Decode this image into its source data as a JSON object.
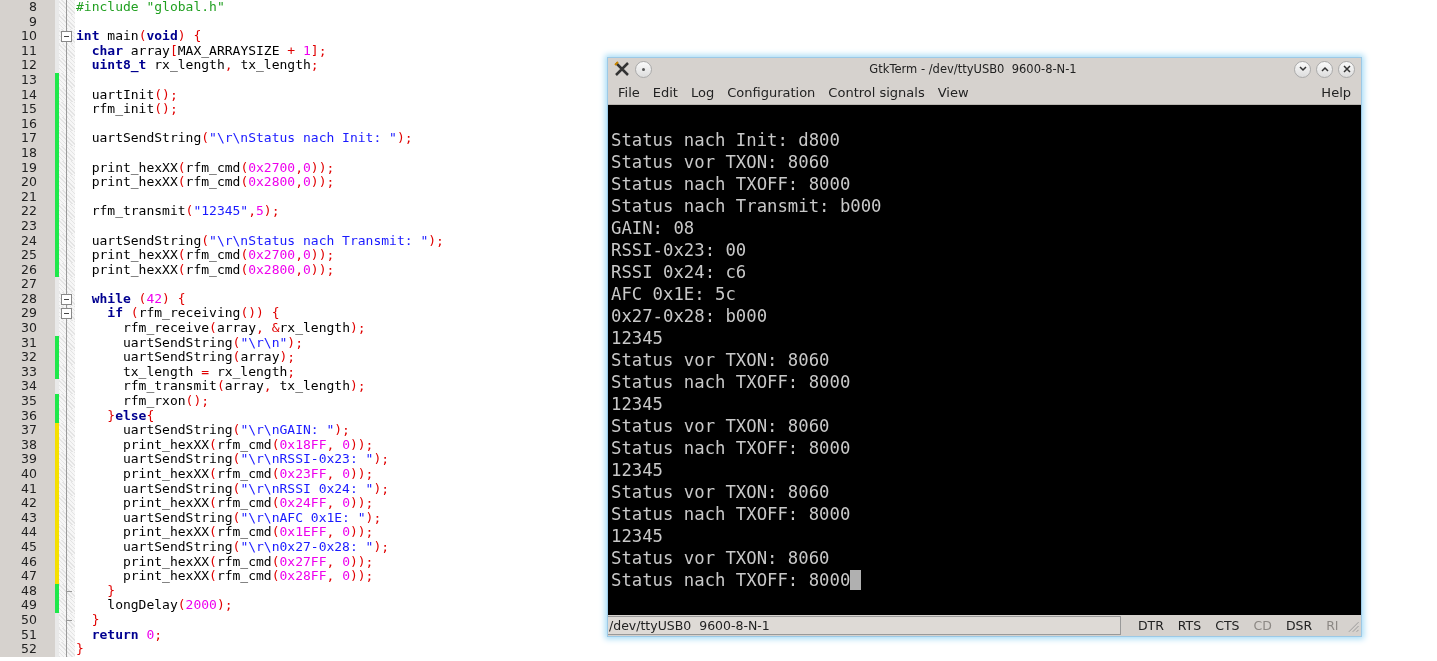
{
  "editor": {
    "lines": [
      {
        "number": "8",
        "tokens": [
          {
            "kind": "pre",
            "t": "#include \"global.h\""
          }
        ]
      },
      {
        "number": "9"
      },
      {
        "number": "10",
        "expanded": true,
        "tokens": [
          {
            "kind": "kw",
            "t": "int"
          },
          {
            "kind": "plain",
            "t": " main"
          },
          {
            "kind": "op",
            "t": "("
          },
          {
            "kind": "kw",
            "t": "void"
          },
          {
            "kind": "op",
            "t": ") {"
          }
        ]
      },
      {
        "number": "11",
        "tokens": [
          {
            "kind": "kw",
            "t": "  char"
          },
          {
            "kind": "plain",
            "t": " array"
          },
          {
            "kind": "op",
            "t": "["
          },
          {
            "kind": "plain",
            "t": "MAX_ARRAYSIZE "
          },
          {
            "kind": "op",
            "t": "+ "
          },
          {
            "kind": "num",
            "t": "1"
          },
          {
            "kind": "op",
            "t": "];"
          }
        ]
      },
      {
        "number": "12",
        "tokens": [
          {
            "kind": "kw",
            "t": "  uint8_t"
          },
          {
            "kind": "plain",
            "t": " rx_length"
          },
          {
            "kind": "op",
            "t": ","
          },
          {
            "kind": "plain",
            "t": " tx_length"
          },
          {
            "kind": "op",
            "t": ";"
          }
        ]
      },
      {
        "number": "13",
        "color": "#1ee84a"
      },
      {
        "number": "14",
        "color": "#1ee84a",
        "tokens": [
          {
            "kind": "plain",
            "t": "  uartInit"
          },
          {
            "kind": "op",
            "t": "();"
          }
        ]
      },
      {
        "number": "15",
        "color": "#1ee84a",
        "tokens": [
          {
            "kind": "plain",
            "t": "  rfm_init"
          },
          {
            "kind": "op",
            "t": "();"
          }
        ]
      },
      {
        "number": "16",
        "color": "#1ee84a"
      },
      {
        "number": "17",
        "color": "#1ee84a",
        "tokens": [
          {
            "kind": "plain",
            "t": "  uartSendString"
          },
          {
            "kind": "op",
            "t": "("
          },
          {
            "kind": "str",
            "t": "\"\\r\\nStatus nach Init: \""
          },
          {
            "kind": "op",
            "t": ");"
          }
        ]
      },
      {
        "number": "18",
        "color": "#1ee84a"
      },
      {
        "number": "19",
        "color": "#1ee84a",
        "tokens": [
          {
            "kind": "plain",
            "t": "  print_hexXX"
          },
          {
            "kind": "op",
            "t": "("
          },
          {
            "kind": "plain",
            "t": "rfm_cmd"
          },
          {
            "kind": "op",
            "t": "("
          },
          {
            "kind": "num",
            "t": "0x2700"
          },
          {
            "kind": "op",
            "t": ","
          },
          {
            "kind": "num",
            "t": "0"
          },
          {
            "kind": "op",
            "t": "));"
          }
        ]
      },
      {
        "number": "20",
        "color": "#1ee84a",
        "tokens": [
          {
            "kind": "plain",
            "t": "  print_hexXX"
          },
          {
            "kind": "op",
            "t": "("
          },
          {
            "kind": "plain",
            "t": "rfm_cmd"
          },
          {
            "kind": "op",
            "t": "("
          },
          {
            "kind": "num",
            "t": "0x2800"
          },
          {
            "kind": "op",
            "t": ","
          },
          {
            "kind": "num",
            "t": "0"
          },
          {
            "kind": "op",
            "t": "));"
          }
        ]
      },
      {
        "number": "21",
        "color": "#1ee84a"
      },
      {
        "number": "22",
        "color": "#1ee84a",
        "tokens": [
          {
            "kind": "plain",
            "t": "  rfm_transmit"
          },
          {
            "kind": "op",
            "t": "("
          },
          {
            "kind": "str",
            "t": "\"12345\""
          },
          {
            "kind": "op",
            "t": ","
          },
          {
            "kind": "num",
            "t": "5"
          },
          {
            "kind": "op",
            "t": ");"
          }
        ]
      },
      {
        "number": "23",
        "color": "#1ee84a"
      },
      {
        "number": "24",
        "color": "#1ee84a",
        "tokens": [
          {
            "kind": "plain",
            "t": "  uartSendString"
          },
          {
            "kind": "op",
            "t": "("
          },
          {
            "kind": "str",
            "t": "\"\\r\\nStatus nach Transmit: \""
          },
          {
            "kind": "op",
            "t": ");"
          }
        ]
      },
      {
        "number": "25",
        "color": "#1ee84a",
        "tokens": [
          {
            "kind": "plain",
            "t": "  print_hexXX"
          },
          {
            "kind": "op",
            "t": "("
          },
          {
            "kind": "plain",
            "t": "rfm_cmd"
          },
          {
            "kind": "op",
            "t": "("
          },
          {
            "kind": "num",
            "t": "0x2700"
          },
          {
            "kind": "op",
            "t": ","
          },
          {
            "kind": "num",
            "t": "0"
          },
          {
            "kind": "op",
            "t": "));"
          }
        ]
      },
      {
        "number": "26",
        "color": "#1ee84a",
        "tokens": [
          {
            "kind": "plain",
            "t": "  print_hexXX"
          },
          {
            "kind": "op",
            "t": "("
          },
          {
            "kind": "plain",
            "t": "rfm_cmd"
          },
          {
            "kind": "op",
            "t": "("
          },
          {
            "kind": "num",
            "t": "0x2800"
          },
          {
            "kind": "op",
            "t": ","
          },
          {
            "kind": "num",
            "t": "0"
          },
          {
            "kind": "op",
            "t": "));"
          }
        ]
      },
      {
        "number": "27"
      },
      {
        "number": "28",
        "expanded": true,
        "tokens": [
          {
            "kind": "kw",
            "t": "  while"
          },
          {
            "kind": "op",
            "t": " ("
          },
          {
            "kind": "num",
            "t": "42"
          },
          {
            "kind": "op",
            "t": ") {"
          }
        ]
      },
      {
        "number": "29",
        "expanded": true,
        "tokens": [
          {
            "kind": "kw",
            "t": "    if"
          },
          {
            "kind": "op",
            "t": " ("
          },
          {
            "kind": "plain",
            "t": "rfm_receiving"
          },
          {
            "kind": "op",
            "t": "()) {"
          }
        ]
      },
      {
        "number": "30",
        "tokens": [
          {
            "kind": "plain",
            "t": "      rfm_receive"
          },
          {
            "kind": "op",
            "t": "("
          },
          {
            "kind": "plain",
            "t": "array"
          },
          {
            "kind": "op",
            "t": ", &"
          },
          {
            "kind": "plain",
            "t": "rx_length"
          },
          {
            "kind": "op",
            "t": ");"
          }
        ]
      },
      {
        "number": "31",
        "color": "#1ee84a",
        "tokens": [
          {
            "kind": "plain",
            "t": "      uartSendString"
          },
          {
            "kind": "op",
            "t": "("
          },
          {
            "kind": "str",
            "t": "\"\\r\\n\""
          },
          {
            "kind": "op",
            "t": ");"
          }
        ]
      },
      {
        "number": "32",
        "color": "#1ee84a",
        "tokens": [
          {
            "kind": "plain",
            "t": "      uartSendString"
          },
          {
            "kind": "op",
            "t": "("
          },
          {
            "kind": "plain",
            "t": "array"
          },
          {
            "kind": "op",
            "t": ");"
          }
        ]
      },
      {
        "number": "33",
        "color": "#1ee84a",
        "tokens": [
          {
            "kind": "plain",
            "t": "      tx_length "
          },
          {
            "kind": "op",
            "t": "="
          },
          {
            "kind": "plain",
            "t": " rx_length"
          },
          {
            "kind": "op",
            "t": ";"
          }
        ]
      },
      {
        "number": "34",
        "tokens": [
          {
            "kind": "plain",
            "t": "      rfm_transmit"
          },
          {
            "kind": "op",
            "t": "("
          },
          {
            "kind": "plain",
            "t": "array"
          },
          {
            "kind": "op",
            "t": ","
          },
          {
            "kind": "plain",
            "t": " tx_length"
          },
          {
            "kind": "op",
            "t": ");"
          }
        ]
      },
      {
        "number": "35",
        "color": "#1ee84a",
        "tokens": [
          {
            "kind": "plain",
            "t": "      rfm_rxon"
          },
          {
            "kind": "op",
            "t": "();"
          }
        ]
      },
      {
        "number": "36",
        "color": "#1ee84a",
        "tokens": [
          {
            "kind": "op",
            "t": "    }"
          },
          {
            "kind": "kw",
            "t": "else"
          },
          {
            "kind": "op",
            "t": "{"
          }
        ]
      },
      {
        "number": "37",
        "color": "#f5e000",
        "tokens": [
          {
            "kind": "plain",
            "t": "      uartSendString"
          },
          {
            "kind": "op",
            "t": "("
          },
          {
            "kind": "str",
            "t": "\"\\r\\nGAIN: \""
          },
          {
            "kind": "op",
            "t": ");"
          }
        ]
      },
      {
        "number": "38",
        "color": "#f5e000",
        "tokens": [
          {
            "kind": "plain",
            "t": "      print_hexXX"
          },
          {
            "kind": "op",
            "t": "("
          },
          {
            "kind": "plain",
            "t": "rfm_cmd"
          },
          {
            "kind": "op",
            "t": "("
          },
          {
            "kind": "num",
            "t": "0x18FF"
          },
          {
            "kind": "op",
            "t": ", "
          },
          {
            "kind": "num",
            "t": "0"
          },
          {
            "kind": "op",
            "t": "));"
          }
        ]
      },
      {
        "number": "39",
        "color": "#f5e000",
        "tokens": [
          {
            "kind": "plain",
            "t": "      uartSendString"
          },
          {
            "kind": "op",
            "t": "("
          },
          {
            "kind": "str",
            "t": "\"\\r\\nRSSI-0x23: \""
          },
          {
            "kind": "op",
            "t": ");"
          }
        ]
      },
      {
        "number": "40",
        "color": "#f5e000",
        "tokens": [
          {
            "kind": "plain",
            "t": "      print_hexXX"
          },
          {
            "kind": "op",
            "t": "("
          },
          {
            "kind": "plain",
            "t": "rfm_cmd"
          },
          {
            "kind": "op",
            "t": "("
          },
          {
            "kind": "num",
            "t": "0x23FF"
          },
          {
            "kind": "op",
            "t": ", "
          },
          {
            "kind": "num",
            "t": "0"
          },
          {
            "kind": "op",
            "t": "));"
          }
        ]
      },
      {
        "number": "41",
        "color": "#f5e000",
        "tokens": [
          {
            "kind": "plain",
            "t": "      uartSendString"
          },
          {
            "kind": "op",
            "t": "("
          },
          {
            "kind": "str",
            "t": "\"\\r\\nRSSI 0x24: \""
          },
          {
            "kind": "op",
            "t": ");"
          }
        ]
      },
      {
        "number": "42",
        "color": "#f5e000",
        "tokens": [
          {
            "kind": "plain",
            "t": "      print_hexXX"
          },
          {
            "kind": "op",
            "t": "("
          },
          {
            "kind": "plain",
            "t": "rfm_cmd"
          },
          {
            "kind": "op",
            "t": "("
          },
          {
            "kind": "num",
            "t": "0x24FF"
          },
          {
            "kind": "op",
            "t": ", "
          },
          {
            "kind": "num",
            "t": "0"
          },
          {
            "kind": "op",
            "t": "));"
          }
        ]
      },
      {
        "number": "43",
        "color": "#f5e000",
        "tokens": [
          {
            "kind": "plain",
            "t": "      uartSendString"
          },
          {
            "kind": "op",
            "t": "("
          },
          {
            "kind": "str",
            "t": "\"\\r\\nAFC 0x1E: \""
          },
          {
            "kind": "op",
            "t": ");"
          }
        ]
      },
      {
        "number": "44",
        "color": "#f5e000",
        "tokens": [
          {
            "kind": "plain",
            "t": "      print_hexXX"
          },
          {
            "kind": "op",
            "t": "("
          },
          {
            "kind": "plain",
            "t": "rfm_cmd"
          },
          {
            "kind": "op",
            "t": "("
          },
          {
            "kind": "num",
            "t": "0x1EFF"
          },
          {
            "kind": "op",
            "t": ", "
          },
          {
            "kind": "num",
            "t": "0"
          },
          {
            "kind": "op",
            "t": "));"
          }
        ]
      },
      {
        "number": "45",
        "color": "#f5e000",
        "tokens": [
          {
            "kind": "plain",
            "t": "      uartSendString"
          },
          {
            "kind": "op",
            "t": "("
          },
          {
            "kind": "str",
            "t": "\"\\r\\n0x27-0x28: \""
          },
          {
            "kind": "op",
            "t": ");"
          }
        ]
      },
      {
        "number": "46",
        "color": "#f5e000",
        "tokens": [
          {
            "kind": "plain",
            "t": "      print_hexXX"
          },
          {
            "kind": "op",
            "t": "("
          },
          {
            "kind": "plain",
            "t": "rfm_cmd"
          },
          {
            "kind": "op",
            "t": "("
          },
          {
            "kind": "num",
            "t": "0x27FF"
          },
          {
            "kind": "op",
            "t": ", "
          },
          {
            "kind": "num",
            "t": "0"
          },
          {
            "kind": "op",
            "t": "));"
          }
        ]
      },
      {
        "number": "47",
        "color": "#f5e000",
        "tokens": [
          {
            "kind": "plain",
            "t": "      print_hexXX"
          },
          {
            "kind": "op",
            "t": "("
          },
          {
            "kind": "plain",
            "t": "rfm_cmd"
          },
          {
            "kind": "op",
            "t": "("
          },
          {
            "kind": "num",
            "t": "0x28FF"
          },
          {
            "kind": "op",
            "t": ", "
          },
          {
            "kind": "num",
            "t": "0"
          },
          {
            "kind": "op",
            "t": "));"
          }
        ]
      },
      {
        "number": "48",
        "color": "#1ee84a",
        "block_end": true,
        "tokens": [
          {
            "kind": "op",
            "t": "    }"
          }
        ]
      },
      {
        "number": "49",
        "color": "#1ee84a",
        "tokens": [
          {
            "kind": "plain",
            "t": "    longDelay"
          },
          {
            "kind": "op",
            "t": "("
          },
          {
            "kind": "num",
            "t": "2000"
          },
          {
            "kind": "op",
            "t": ");"
          }
        ]
      },
      {
        "number": "50",
        "block_end": true,
        "tokens": [
          {
            "kind": "op",
            "t": "  }"
          }
        ]
      },
      {
        "number": "51",
        "tokens": [
          {
            "kind": "kw",
            "t": "  return"
          },
          {
            "kind": "num",
            "t": " 0"
          },
          {
            "kind": "op",
            "t": ";"
          }
        ]
      },
      {
        "number": "52",
        "tokens": [
          {
            "kind": "op",
            "t": "}"
          }
        ]
      }
    ]
  },
  "terminal": {
    "title": "GtkTerm - /dev/ttyUSB0  9600-8-N-1",
    "menu": [
      "File",
      "Edit",
      "Log",
      "Configuration",
      "Control signals",
      "View"
    ],
    "help": "Help",
    "output": [
      "Status nach Init: d800",
      "Status vor TXON: 8060",
      "Status nach TXOFF: 8000",
      "Status nach Transmit: b000",
      "GAIN: 08",
      "RSSI-0x23: 00",
      "RSSI 0x24: c6",
      "AFC 0x1E: 5c",
      "0x27-0x28: b000",
      "12345",
      "Status vor TXON: 8060",
      "Status nach TXOFF: 8000",
      "12345",
      "Status vor TXON: 8060",
      "Status nach TXOFF: 8000",
      "12345",
      "Status vor TXON: 8060",
      "Status nach TXOFF: 8000",
      "12345",
      "Status vor TXON: 8060",
      "Status nach TXOFF: 8000"
    ],
    "status": {
      "port": "/dev/ttyUSB0  9600-8-N-1",
      "signals": [
        {
          "label": "DTR",
          "disabled": false
        },
        {
          "label": "RTS",
          "disabled": false
        },
        {
          "label": "CTS",
          "disabled": false
        },
        {
          "label": "CD",
          "disabled": true
        },
        {
          "label": "DSR",
          "disabled": false
        },
        {
          "label": "RI",
          "disabled": true
        }
      ]
    }
  }
}
